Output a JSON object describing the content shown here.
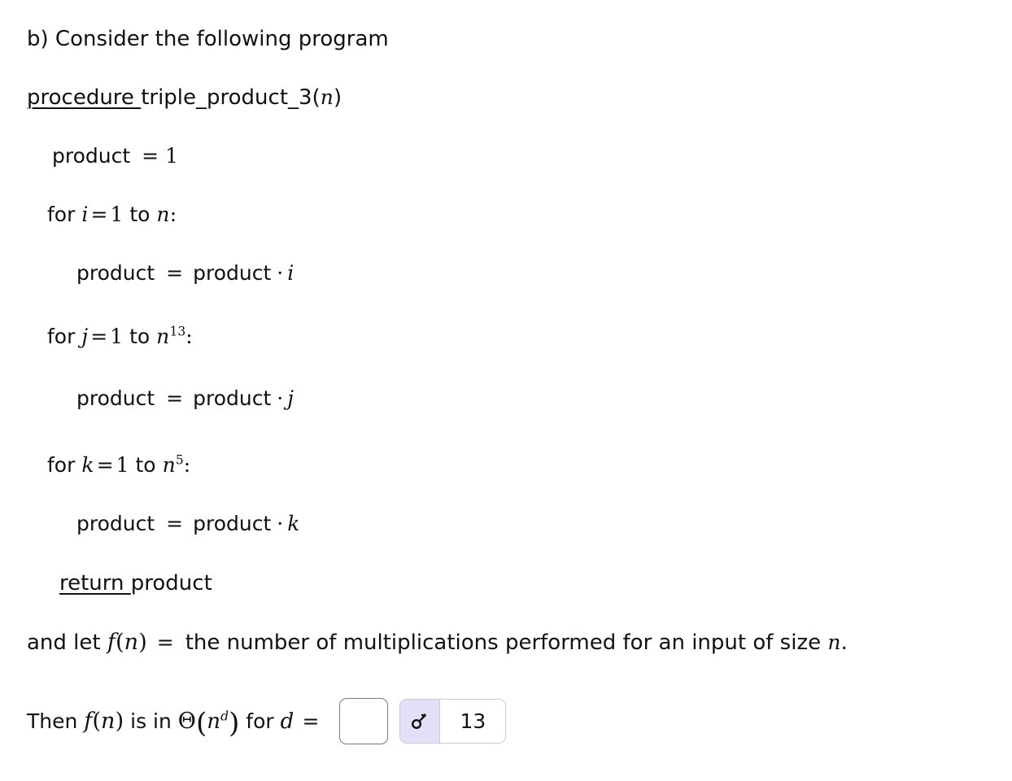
{
  "document": {
    "prompt": "b) Consider the following program",
    "procedure": {
      "keyword": "procedure ",
      "name": "triple_product_3(",
      "param": "n",
      "close": ")"
    },
    "code_lines": [
      {
        "id": "init-product",
        "indent": 64,
        "parts": [
          "product",
          "=",
          "1"
        ],
        "text": "product  =  1"
      },
      {
        "id": "for-i",
        "indent": 58,
        "text": "for i = 1 to n:",
        "var": "i",
        "from": "1",
        "to": "n",
        "exponent": ""
      },
      {
        "id": "body-i",
        "indent": 94,
        "text": "product  =  product · i",
        "factor": "i"
      },
      {
        "id": "for-j",
        "indent": 58,
        "text": "for j = 1 to n^13:",
        "var": "j",
        "from": "1",
        "to": "n",
        "exponent": "13"
      },
      {
        "id": "body-j",
        "indent": 94,
        "text": "product  =  product · j",
        "factor": "j"
      },
      {
        "id": "for-k",
        "indent": 58,
        "text": "for k = 1 to n^5:",
        "var": "k",
        "from": "1",
        "to": "n",
        "exponent": "5"
      },
      {
        "id": "body-k",
        "indent": 94,
        "text": "product  =  product · k",
        "factor": "k"
      }
    ],
    "return_statement": {
      "keyword": "return ",
      "value": "product"
    },
    "definition_sentence": {
      "lead": "and let ",
      "fn": "f",
      "open": "(",
      "arg": "n",
      "close": ")",
      "equals": "=",
      "tail": "the number of multiplications performed for an input of size ",
      "tail_var": "n",
      "period": "."
    },
    "question_sentence": {
      "lead": "Then ",
      "fn": "f",
      "open": "(",
      "arg": "n",
      "close": ")",
      "middle": " is in ",
      "theta": "Θ",
      "big_open": "(",
      "base": "n",
      "exponent": "d",
      "big_close": ")",
      "for_text": " for ",
      "variable": "d",
      "equals": "="
    }
  },
  "answer": {
    "input_value": "",
    "input_placeholder": "",
    "feedback_icon": "key-icon",
    "feedback_value": "13",
    "icon_background": "#e2e0f7",
    "border_color": "#c9c9d6"
  },
  "literals": {
    "product": "product",
    "equals": "=",
    "one": "1",
    "for": "for",
    "to": "to",
    "colon": ":",
    "dot": "·"
  }
}
